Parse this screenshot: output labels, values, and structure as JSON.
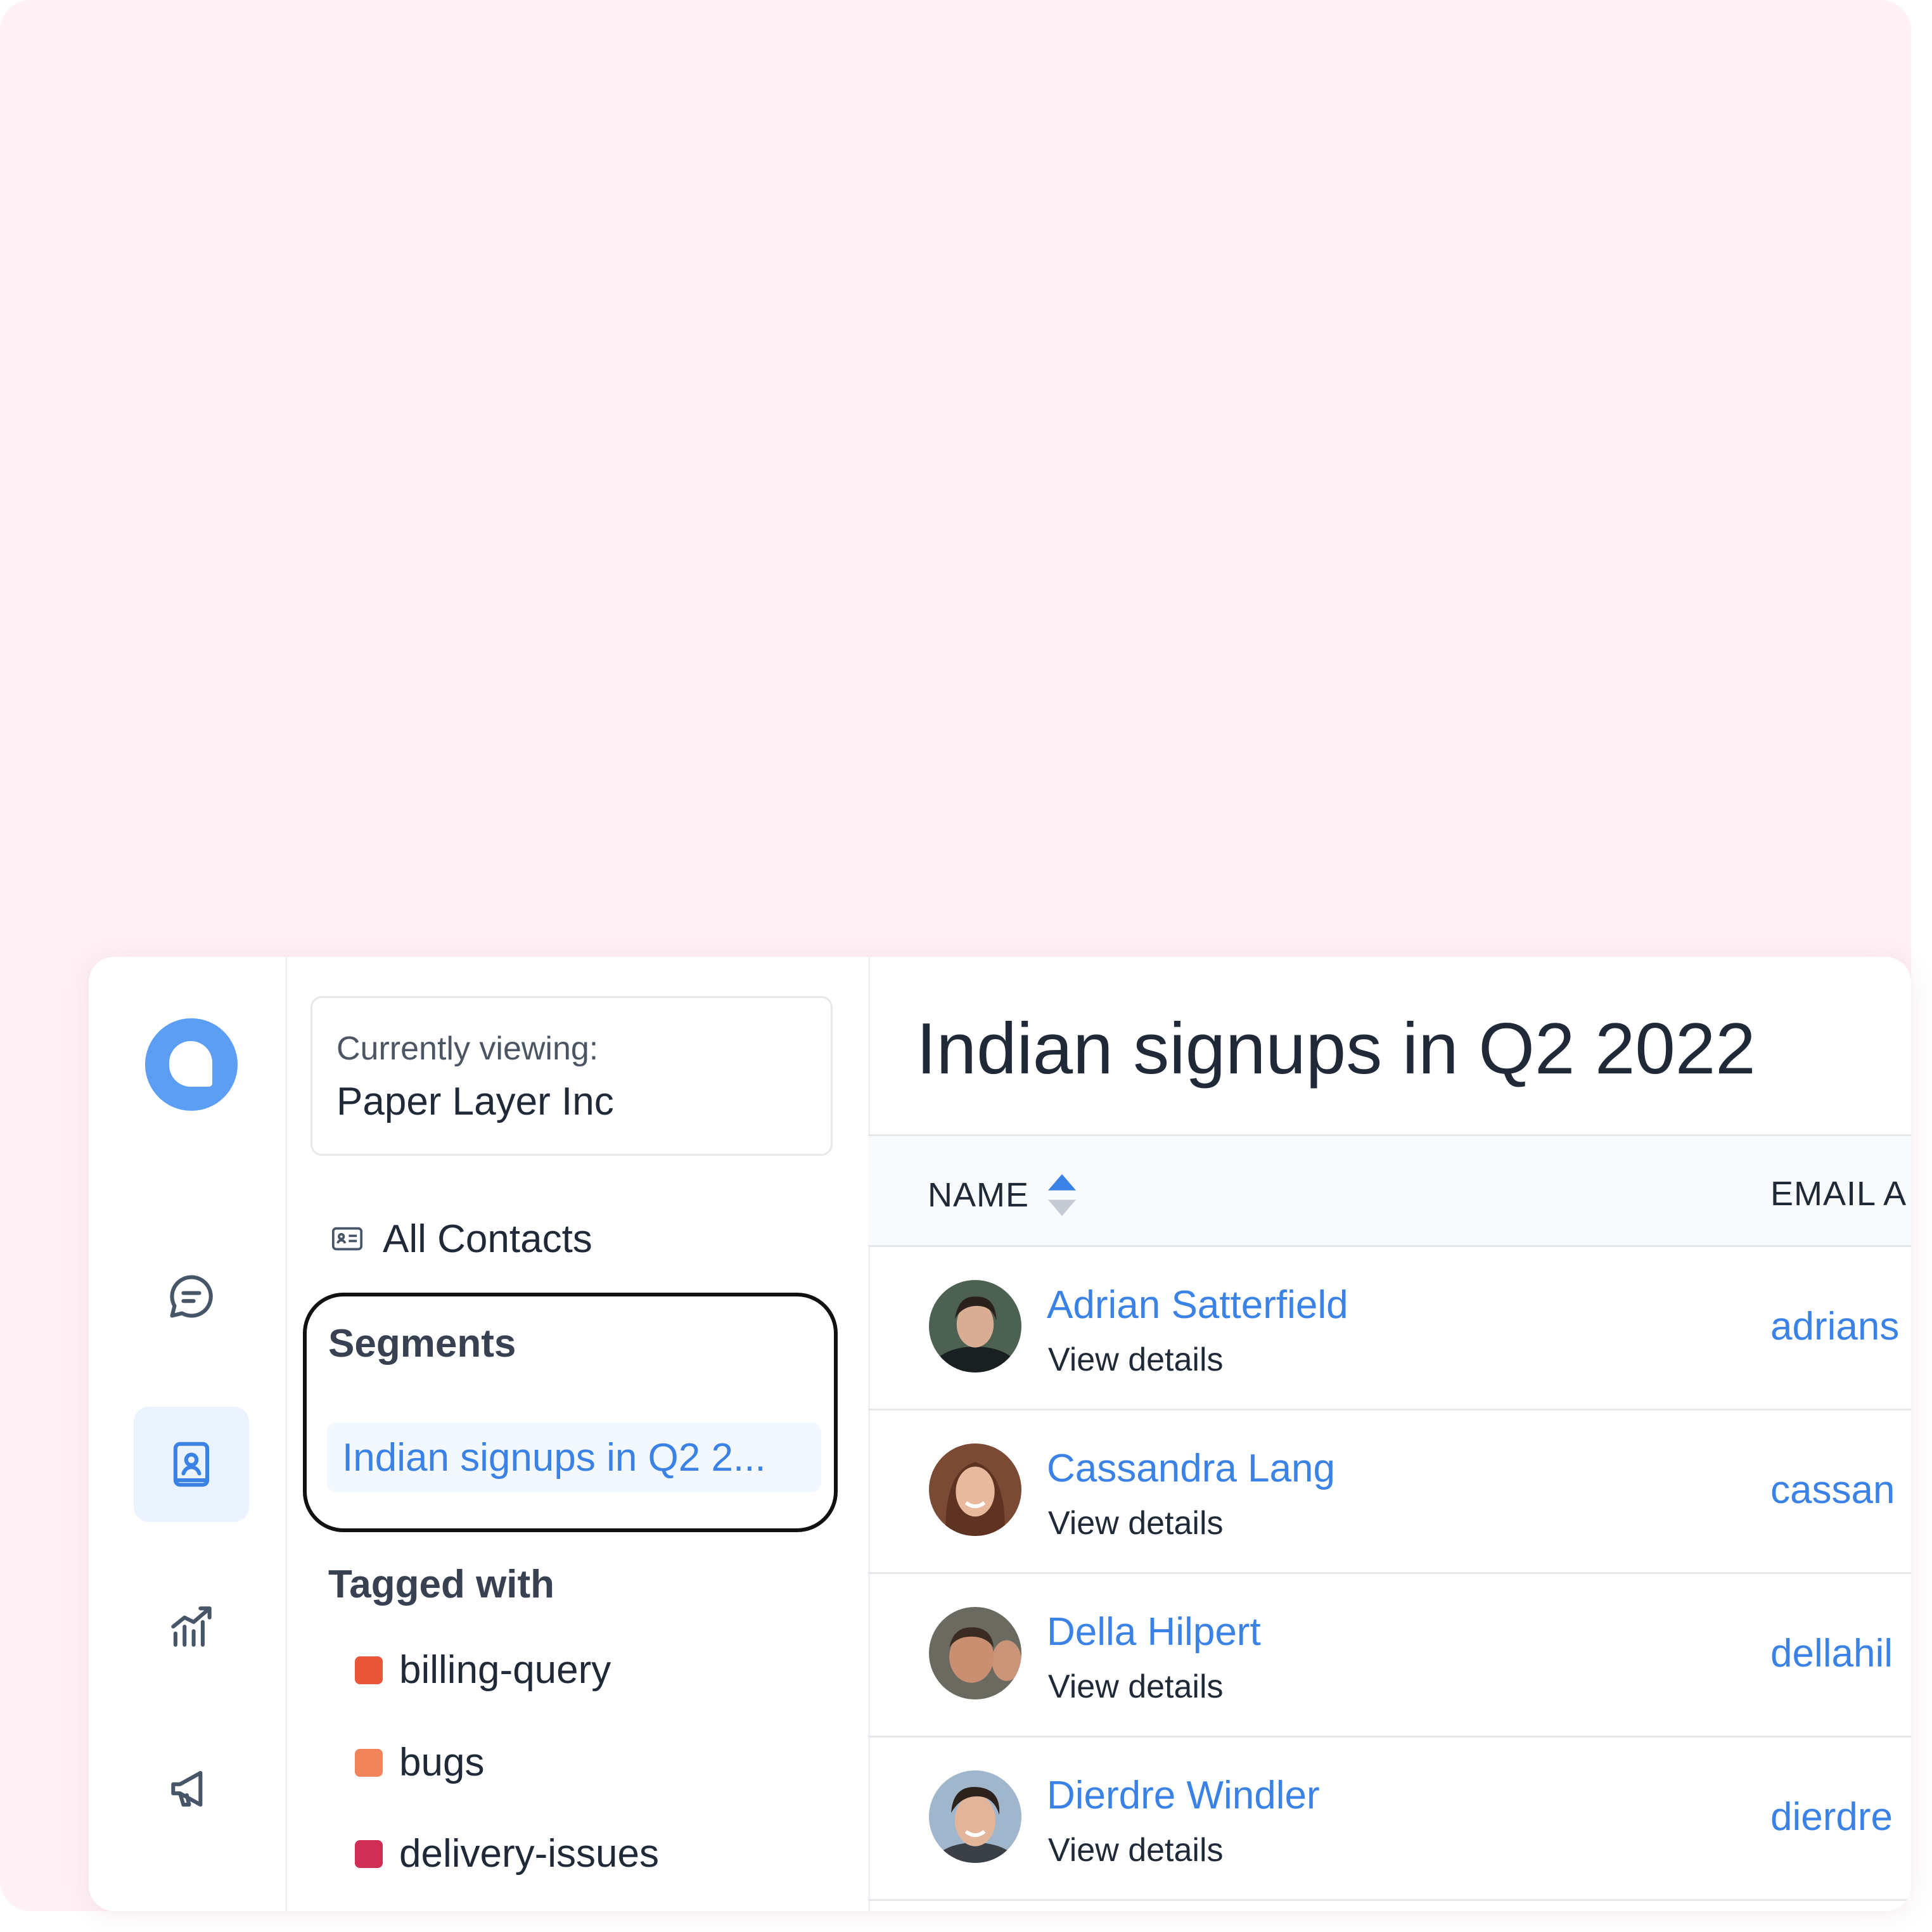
{
  "sidebar_context": {
    "label": "Currently viewing:",
    "value": "Paper Layer Inc"
  },
  "nav": {
    "all_contacts": "All Contacts",
    "segments_title": "Segments",
    "segments": [
      {
        "label": "Indian signups in Q2 2..."
      }
    ],
    "tagged_title": "Tagged with",
    "tags": [
      {
        "label": "billing-query",
        "color": "#e8573a"
      },
      {
        "label": "bugs",
        "color": "#f0845a"
      },
      {
        "label": "delivery-issues",
        "color": "#cf2f55"
      }
    ]
  },
  "rail": {
    "icons": [
      "logo-icon",
      "conversations-icon",
      "contacts-icon",
      "reports-icon",
      "campaigns-icon"
    ],
    "active": "contacts-icon"
  },
  "main": {
    "title": "Indian signups in Q2 2022",
    "columns": {
      "name": "NAME",
      "email": "EMAIL A"
    },
    "rows": [
      {
        "name": "Adrian Satterfield",
        "link": "View details",
        "email": "adrians"
      },
      {
        "name": "Cassandra Lang",
        "link": "View details",
        "email": "cassan"
      },
      {
        "name": "Della Hilpert",
        "link": "View details",
        "email": "dellahil"
      },
      {
        "name": "Dierdre Windler",
        "link": "View details",
        "email": "dierdre"
      }
    ]
  },
  "colors": {
    "accent": "#3b82e6",
    "background_pink": "#fff1f6",
    "logo": "#5b9ef4"
  }
}
